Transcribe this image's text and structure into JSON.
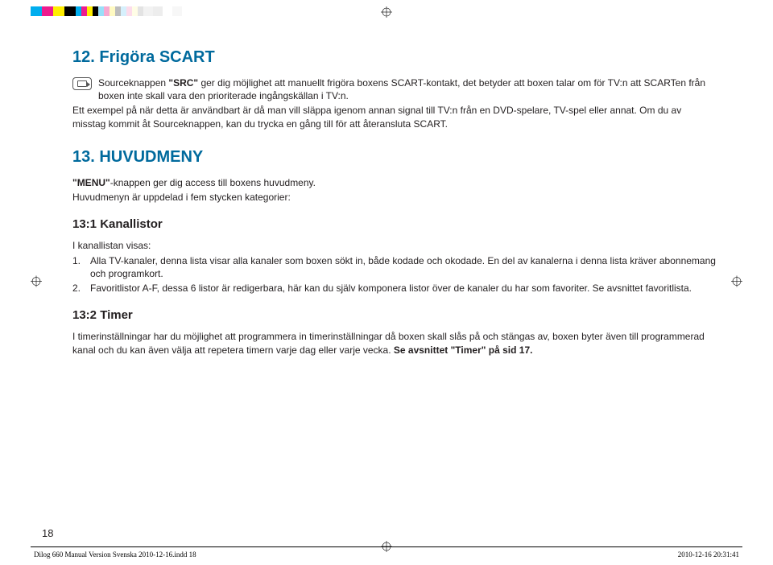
{
  "colorbar": [
    {
      "c": "#00adee",
      "w": 14
    },
    {
      "c": "#ed1b8e",
      "w": 14
    },
    {
      "c": "#ffee00",
      "w": 14
    },
    {
      "c": "#000000",
      "w": 14
    },
    {
      "c": "#00adee",
      "w": 7
    },
    {
      "c": "#ed1b8e",
      "w": 7
    },
    {
      "c": "#ffee00",
      "w": 7
    },
    {
      "c": "#000000",
      "w": 7
    },
    {
      "c": "#99dff8",
      "w": 7
    },
    {
      "c": "#f6a9d1",
      "w": 7
    },
    {
      "c": "#fffac2",
      "w": 7
    },
    {
      "c": "#bdbdbd",
      "w": 7
    },
    {
      "c": "#d6f0fc",
      "w": 7
    },
    {
      "c": "#fcdceb",
      "w": 7
    },
    {
      "c": "#fffde6",
      "w": 7
    },
    {
      "c": "#e3e3e3",
      "w": 7
    },
    {
      "c": "#f2f2f2",
      "w": 12
    },
    {
      "c": "#ededed",
      "w": 12
    },
    {
      "c": "#ffffff",
      "w": 12
    },
    {
      "c": "#f7f7f7",
      "w": 12
    }
  ],
  "h12": "12. Frigöra SCART",
  "p12_lead_pre": "Sourceknappen ",
  "p12_lead_src": "\"SRC\"",
  "p12_lead_post": " ger dig möjlighet att manuellt frigöra boxens SCART-kontakt, det betyder att boxen talar om för TV:n att SCARTen från boxen inte skall vara den prioriterade ingångskällan i TV:n.",
  "p12_b": "Ett exempel på när detta är användbart är då man vill släppa igenom annan signal till TV:n från en DVD-spelare, TV-spel eller annat. Om du av misstag kommit åt Sourceknappen, kan du trycka en gång till för att återansluta SCART.",
  "h13": "13. HUVUDMENY",
  "p13a_pre": "",
  "p13a_bold": "\"MENU\"",
  "p13a_post": "-knappen ger dig access till boxens huvudmeny.",
  "p13b": "Huvudmenyn är uppdelad i fem stycken kategorier:",
  "h131": "13:1 Kanallistor",
  "p131_intro": "I kanallistan visas:",
  "li1_pre": "Alla TV-kanaler, denna lista visar alla kanaler som boxen sökt in, både kodade och okodade. En del av kanalerna i denna lista kräver abonnemang och programkort.",
  "li2_pre": "Favoritlistor A-F, dessa 6 listor är redigerbara, här kan du själv komponera listor över de kanaler du har som favoriter. Se avsnittet favoritlista.",
  "h132": "13:2 Timer",
  "p132_pre": "I timerinställningar har du möjlighet att programmera in timerinställningar då boxen skall slås på och stängas av, boxen byter även till programmerad kanal och du kan även välja att repetera timern varje dag eller varje vecka. ",
  "p132_bold": "Se avsnittet \"Timer\" på sid 17.",
  "pagenum": "18",
  "footer_left": "Dilog 660 Manual Version Svenska 2010-12-16.indd   18",
  "footer_right": "2010-12-16   20:31:41"
}
